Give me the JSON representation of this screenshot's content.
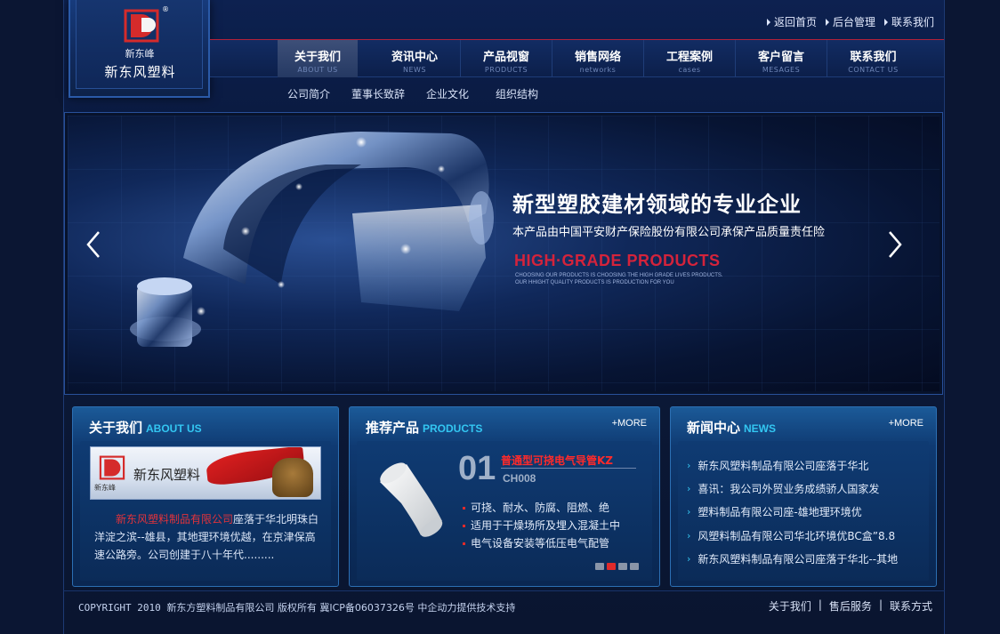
{
  "logo": {
    "brand_small": "新东峰",
    "name": "新东风塑料",
    "registered_mark": "®"
  },
  "top_links": [
    "返回首页",
    "后台管理",
    "联系我们"
  ],
  "nav": [
    {
      "cn": "关于我们",
      "en": "ABOUT US",
      "active": true
    },
    {
      "cn": "资讯中心",
      "en": "NEWS"
    },
    {
      "cn": "产品视窗",
      "en": "PRODUCTS"
    },
    {
      "cn": "销售网络",
      "en": "networks"
    },
    {
      "cn": "工程案例",
      "en": "cases"
    },
    {
      "cn": "客户留言",
      "en": "MESAGES"
    },
    {
      "cn": "联系我们",
      "en": "CONTACT US"
    }
  ],
  "subnav": [
    "公司简介",
    "董事长致辞",
    "企业文化",
    "组织结构"
  ],
  "banner": {
    "title": "新型塑胶建材领域的专业企业",
    "subtitle": "本产品由中国平安财产保险股份有限公司承保产品质量责任险",
    "en_title": "HIGH·GRADE PRODUCTS",
    "en_line1": "CHOOSING OUR PRODUCTS IS CHOOSING THE HIGH GRADE LIVES PRODUCTS.",
    "en_line2": "OUR HHIGHT QUALITY PRODUCTS IS PRODUCTION FOR YOU"
  },
  "about": {
    "title_cn": "关于我们",
    "title_en": "ABOUT US",
    "banner_text": "新东风塑料",
    "banner_small": "新东峰",
    "highlight": "新东风塑料制品有限公司",
    "text": "座落于华北明珠白洋淀之滨--雄县，其地理环境优越，在京津保高速公路旁。公司创建于八十年代........."
  },
  "products": {
    "title_cn": "推荐产品",
    "title_en": "PRODUCTS",
    "more": "+MORE",
    "number": "01",
    "name": "普通型可挠电气导管KZ",
    "code": "CH008",
    "features": [
      "可挠、耐水、防腐、阻燃、绝",
      "适用于干燥场所及埋入混凝土中",
      "电气设备安装等低压电气配管"
    ],
    "dots_active_index": 1,
    "dot_count": 4
  },
  "news": {
    "title_cn": "新闻中心",
    "title_en": "NEWS",
    "more": "+MORE",
    "items": [
      "新东风塑料制品有限公司座落于华北",
      "喜讯：我公司外贸业务成绩骄人国家发",
      "塑料制品有限公司座-雄地理环境优",
      "风塑料制品有限公司华北环境优BC盒”8.8",
      "新东风塑料制品有限公司座落于华北--其地"
    ]
  },
  "footer": {
    "copyright_prefix": "COPYRIGHT 2010",
    "copyright_cn": "新东方塑料制品有限公司 版权所有  冀ICP备06037326号 中企动力提供技术支持",
    "links": [
      "关于我们",
      "售后服务",
      "联系方式"
    ]
  },
  "colors": {
    "accent_red": "#d4233b",
    "accent_cyan": "#33c7f2",
    "background": "#0b1633"
  }
}
